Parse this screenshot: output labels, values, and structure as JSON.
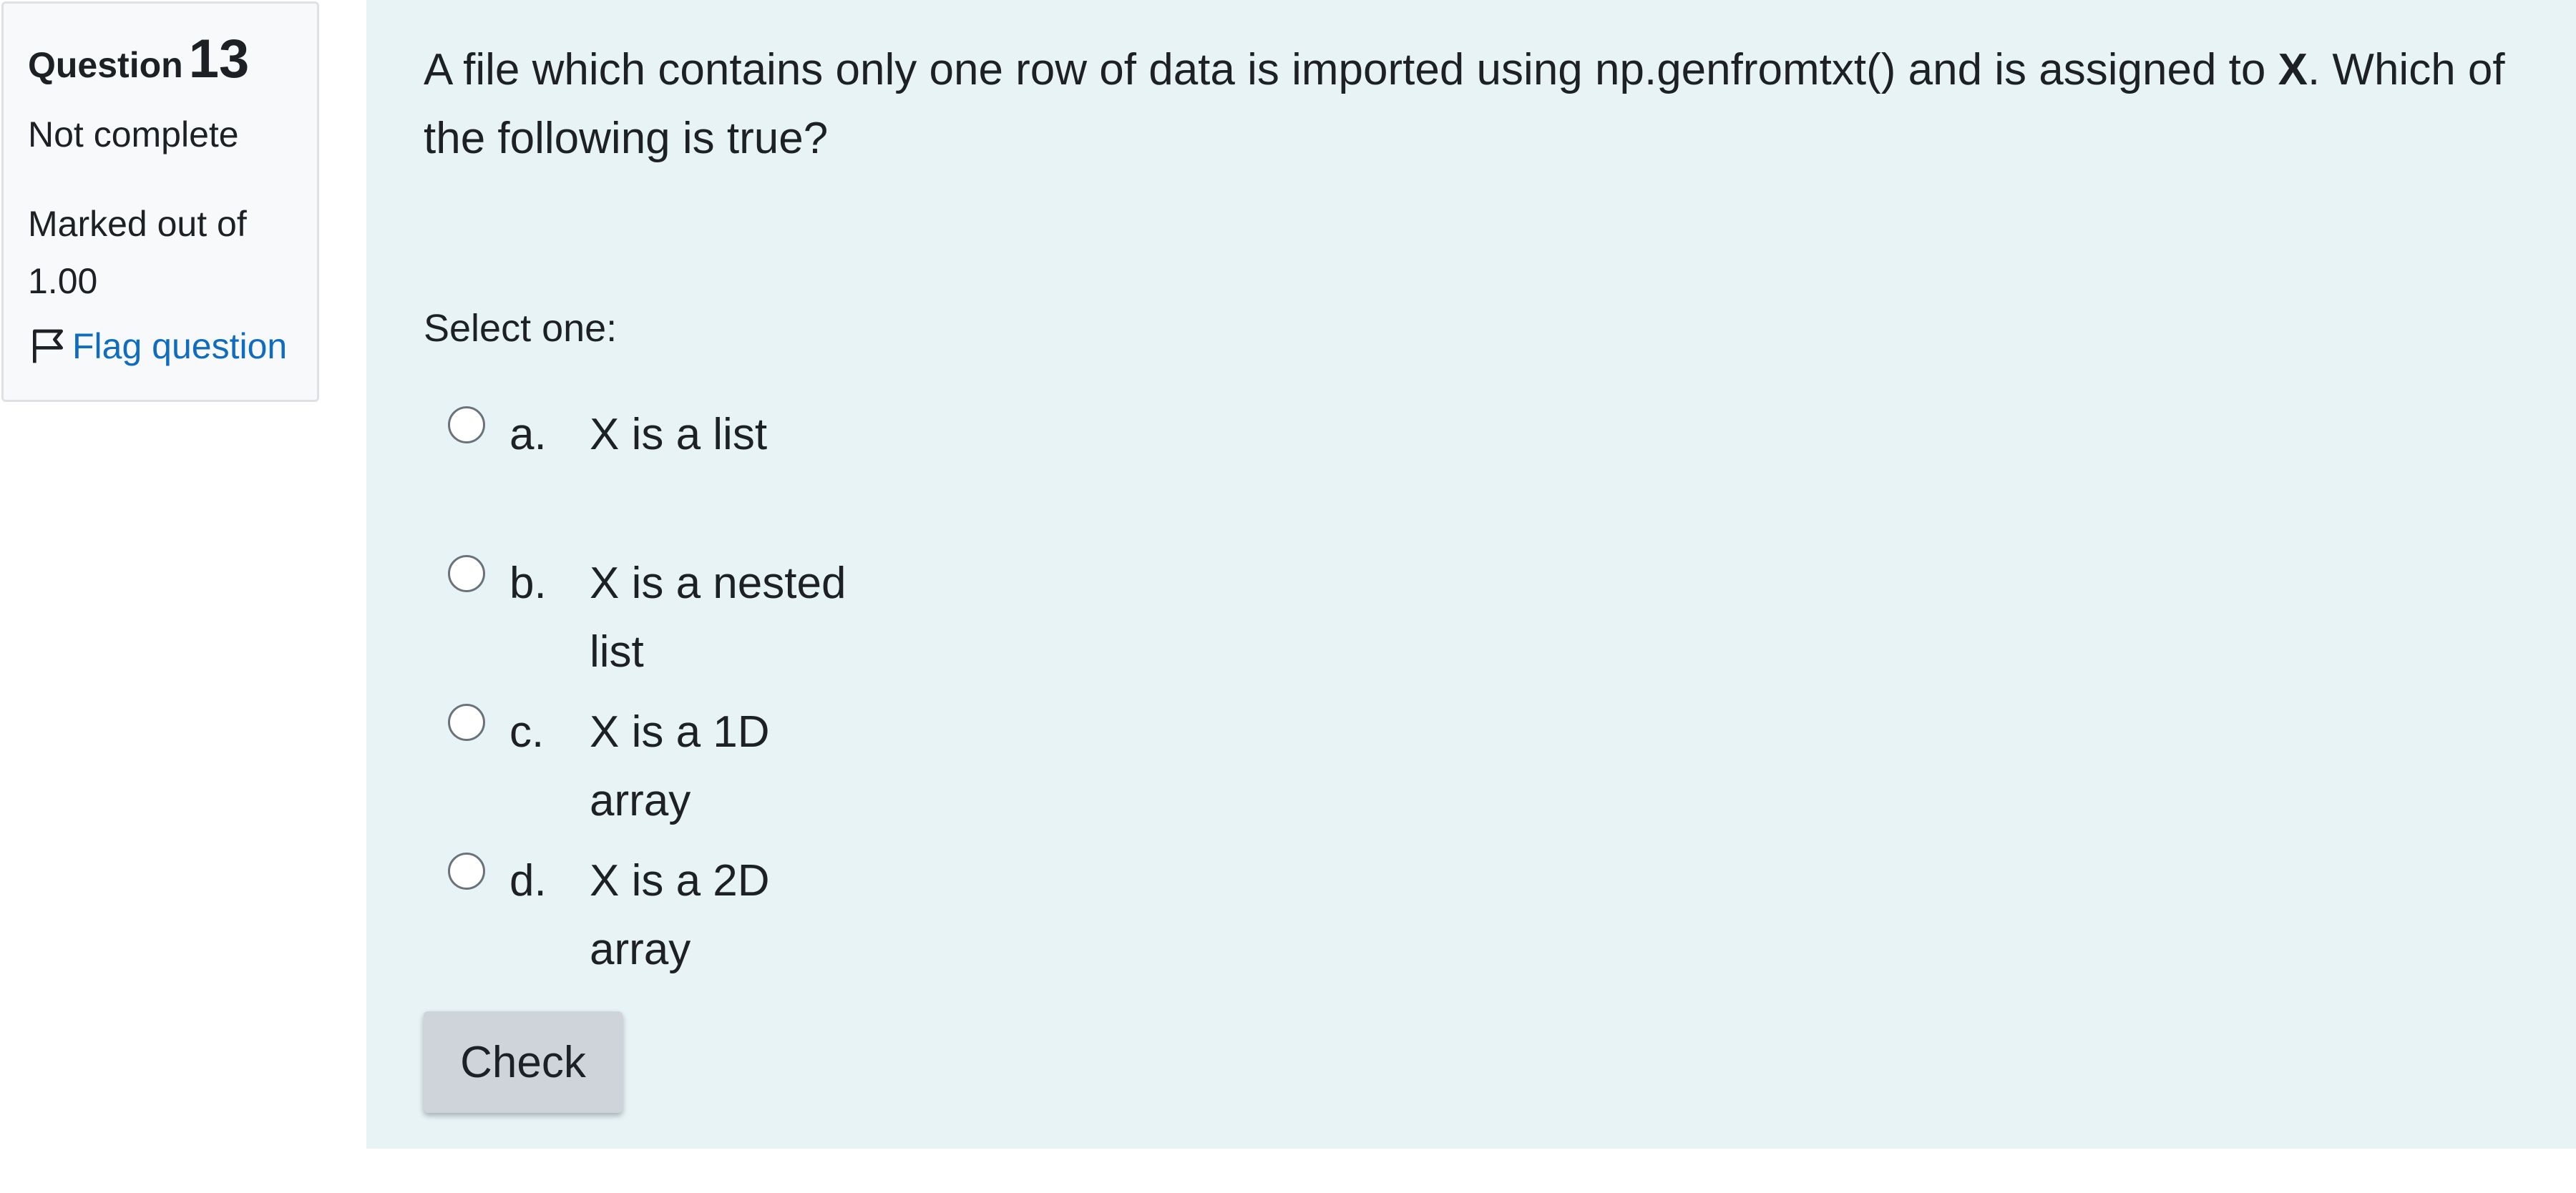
{
  "info": {
    "question_word": "Question",
    "question_number": "13",
    "state": "Not complete",
    "grade": "Marked out of 1.00",
    "flag_label": "Flag question",
    "flag_icon": "flag-icon"
  },
  "question": {
    "text_before": "A file which contains only one row of data is imported using np.genfromtxt() and is assigned to ",
    "text_bold": "X",
    "text_after": ". Which of the following is true?",
    "prompt": "Select one:",
    "options": [
      {
        "letter": "a.",
        "text": "X is a list",
        "selected": false
      },
      {
        "letter": "b.",
        "text": "X is a nested list",
        "selected": false
      },
      {
        "letter": "c.",
        "text": "X is a 1D array",
        "selected": false
      },
      {
        "letter": "d.",
        "text": "X is a 2D array",
        "selected": false
      }
    ],
    "check_label": "Check"
  },
  "colors": {
    "info_background": "#f8f9fa",
    "question_background": "#e7f3f5",
    "link": "#0f6cbf",
    "button": "#ced4da"
  }
}
